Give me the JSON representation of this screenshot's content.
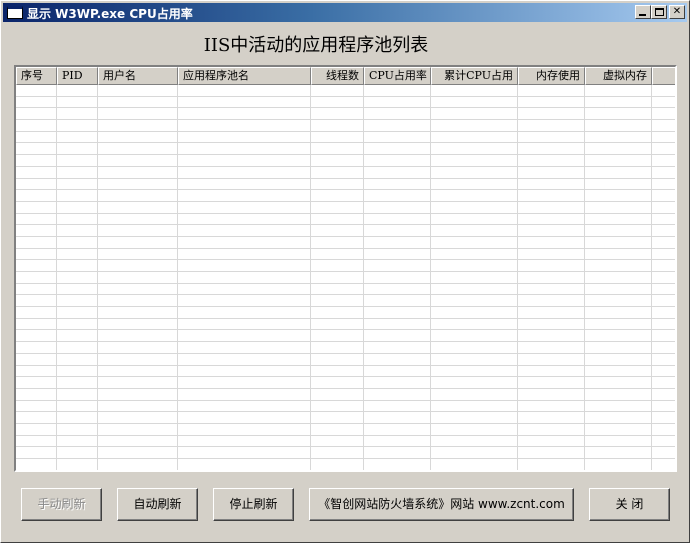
{
  "window": {
    "title": "显示 W3WP.exe CPU占用率"
  },
  "heading": "IIS中活动的应用程序池列表",
  "table": {
    "columns": [
      "序号",
      "PID",
      "用户名",
      "应用程序池名",
      "线程数",
      "CPU占用率",
      "累计CPU占用",
      "内存使用",
      "虚拟内存"
    ],
    "rows": []
  },
  "buttons": {
    "manual_refresh": "手动刷新",
    "auto_refresh": "自动刷新",
    "stop_refresh": "停止刷新",
    "site_link": "《智创网站防火墙系统》网站  www.zcnt.com",
    "close": "关 闭"
  }
}
